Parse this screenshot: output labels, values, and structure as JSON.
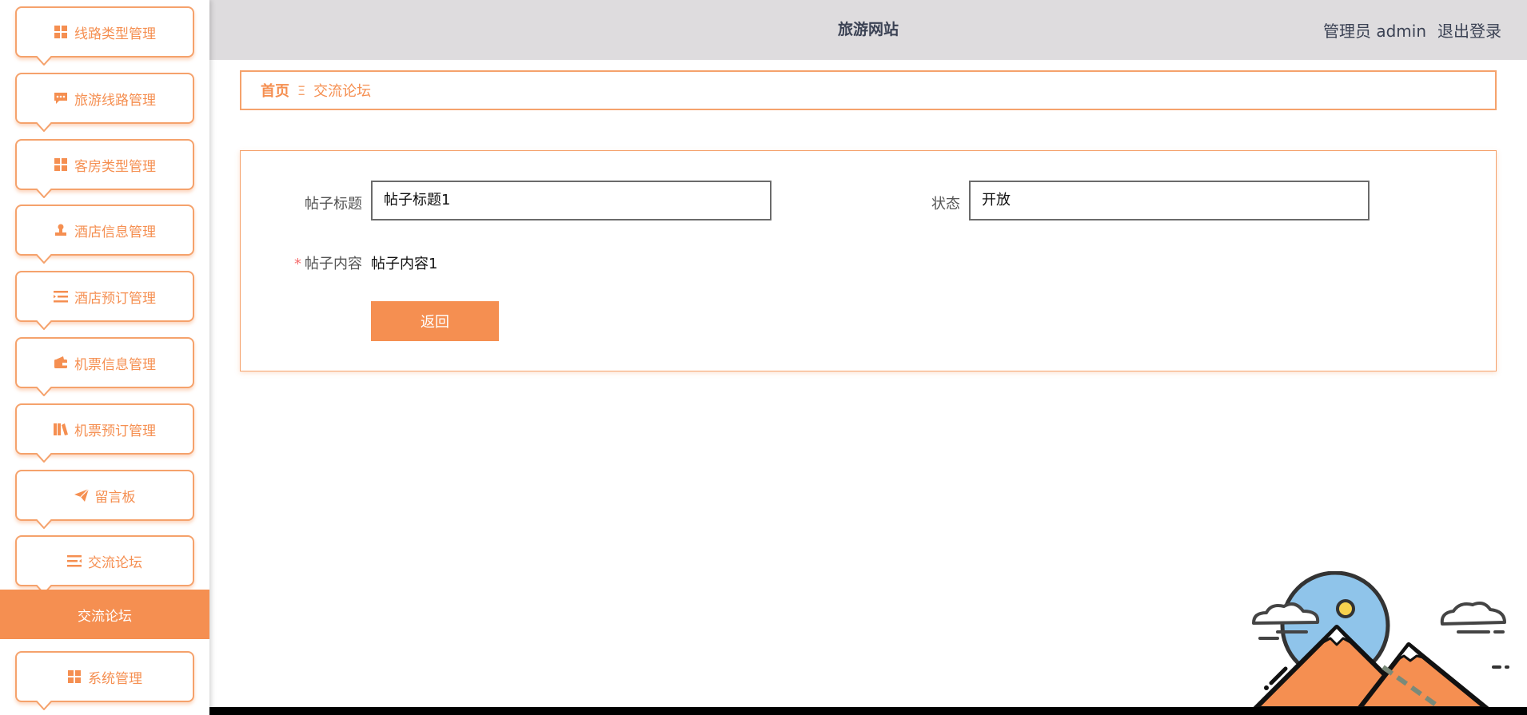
{
  "sidebar": {
    "items": [
      {
        "label": "线路类型管理",
        "icon": "grid-icon"
      },
      {
        "label": "旅游线路管理",
        "icon": "chat-icon"
      },
      {
        "label": "客房类型管理",
        "icon": "grid-icon"
      },
      {
        "label": "酒店信息管理",
        "icon": "stamp-icon"
      },
      {
        "label": "酒店预订管理",
        "icon": "list-icon"
      },
      {
        "label": "机票信息管理",
        "icon": "wallet-icon"
      },
      {
        "label": "机票预订管理",
        "icon": "books-icon"
      },
      {
        "label": "留言板",
        "icon": "send-icon"
      },
      {
        "label": "交流论坛",
        "icon": "menu-icon"
      }
    ],
    "active_label": "交流论坛",
    "last_item": {
      "label": "系统管理",
      "icon": "grid-icon"
    }
  },
  "header": {
    "title": "旅游网站",
    "user_label": "管理员 admin",
    "logout_label": "退出登录"
  },
  "breadcrumb": {
    "home": "首页",
    "separator": "Ξ",
    "current": "交流论坛"
  },
  "form": {
    "title_label": "帖子标题",
    "title_value": "帖子标题1",
    "status_label": "状态",
    "status_value": "开放",
    "content_required_mark": "*",
    "content_label": "帖子内容",
    "content_value": "帖子内容1",
    "back_button": "返回"
  },
  "colors": {
    "accent": "#f58f51",
    "header_bg": "#dedcde",
    "sky": "#8fc4ea"
  }
}
